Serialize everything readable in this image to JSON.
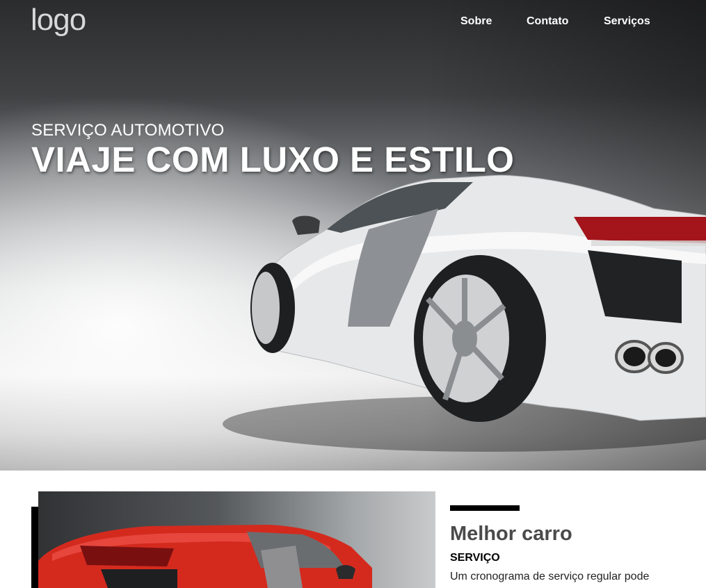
{
  "header": {
    "logo_text": "logo",
    "nav": [
      {
        "label": "Sobre"
      },
      {
        "label": "Contato"
      },
      {
        "label": "Serviços"
      }
    ]
  },
  "hero": {
    "subtitle": "SERVIÇO AUTOMOTIVO",
    "title": "VIAJE COM LUXO E ESTILO",
    "image": "white-sports-car"
  },
  "feature": {
    "image": "red-sports-car",
    "title": "Melhor carro",
    "subtitle": "SERVIÇO",
    "text": "Um cronograma de serviço regular pode"
  },
  "colors": {
    "nav_text": "#ffffff",
    "accent_bar": "#000000",
    "feature_title": "#4a4a4a",
    "red_car": "#d42a1e"
  }
}
